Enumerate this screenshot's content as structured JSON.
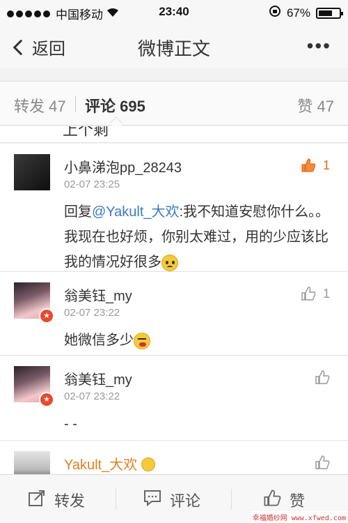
{
  "status": {
    "carrier": "中国移动",
    "time": "23:40",
    "battery": "67%",
    "battery_level": 0.67
  },
  "nav": {
    "back_label": "返回",
    "title": "微博正文"
  },
  "tabs": {
    "repost": "转发 47",
    "comment": "评论 695",
    "like": "赞 47"
  },
  "partial_text": "上个剩",
  "comments": [
    {
      "user": "小鼻涕泡pp_28243",
      "time": "02-07 23:25",
      "reply_prefix": "回复",
      "mention": "@Yakult_大欢",
      "text": ":我不知道安慰你什么。。我现在也好烦，你别太难过，用的少应该比我的情况好很多",
      "likes": "1"
    },
    {
      "user": "翁美钰_my",
      "time": "02-07 23:22",
      "text": "她微信多少",
      "likes": "1"
    },
    {
      "user": "翁美钰_my",
      "time": "02-07 23:22",
      "text": "- -",
      "likes": ""
    },
    {
      "user": "Yakult_大欢",
      "time": "",
      "text": "",
      "likes": ""
    }
  ],
  "bottom": {
    "repost": "转发",
    "comment": "评论",
    "like": "赞"
  },
  "watermark": "幸福婚纱网 www.xfwed.com",
  "colors": {
    "accent": "#e86a1a",
    "mention": "#3b7bbf",
    "vip_badge": "#e84a2b"
  }
}
